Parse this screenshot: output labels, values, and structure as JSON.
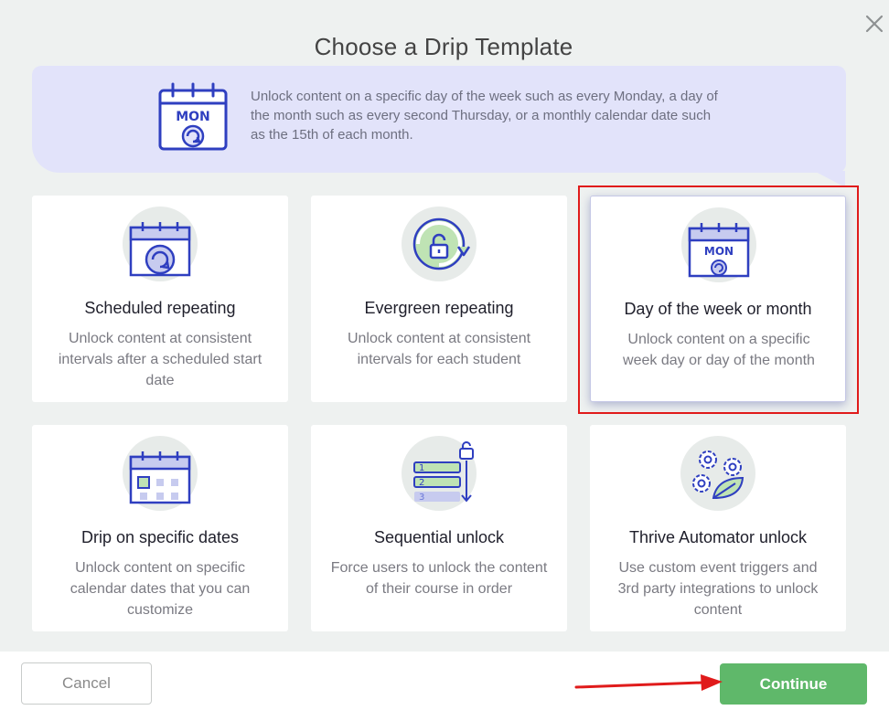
{
  "dialog": {
    "title": "Choose a Drip Template"
  },
  "banner": {
    "text": "Unlock content on a specific day of the week such as every Monday, a day of the month such as every second Thursday, or a monthly calendar date such as the 15th of each month.",
    "icon": "calendar-mon-icon",
    "icon_label": "MON"
  },
  "cards": [
    {
      "title": "Scheduled repeating",
      "description": "Unlock content at consistent intervals after a scheduled start date",
      "icon": "calendar-repeat-icon",
      "selected": false
    },
    {
      "title": "Evergreen repeating",
      "description": "Unlock content at consistent intervals for each student",
      "icon": "padlock-cycle-icon",
      "selected": false
    },
    {
      "title": "Day of the week or month",
      "description": "Unlock content on a specific week day or day of the month",
      "icon": "calendar-mon-icon",
      "icon_label": "MON",
      "selected": true
    },
    {
      "title": "Drip on specific dates",
      "description": "Unlock content on specific calendar dates that you can customize",
      "icon": "calendar-dates-icon",
      "selected": false
    },
    {
      "title": "Sequential unlock",
      "description": "Force users to unlock the content of their course in order",
      "icon": "numbered-list-lock-icon",
      "list_numbers": [
        "1",
        "2",
        "3"
      ],
      "selected": false
    },
    {
      "title": "Thrive Automator unlock",
      "description": "Use custom event triggers and 3rd party integrations to unlock content",
      "icon": "gears-leaf-icon",
      "selected": false
    }
  ],
  "footer": {
    "cancel_label": "Cancel",
    "continue_label": "Continue"
  },
  "colors": {
    "accent_blue": "#2f3fc0",
    "accent_green": "#5fb86a",
    "banner_bg": "#e2e3fa",
    "highlight_red": "#e01b1b"
  }
}
